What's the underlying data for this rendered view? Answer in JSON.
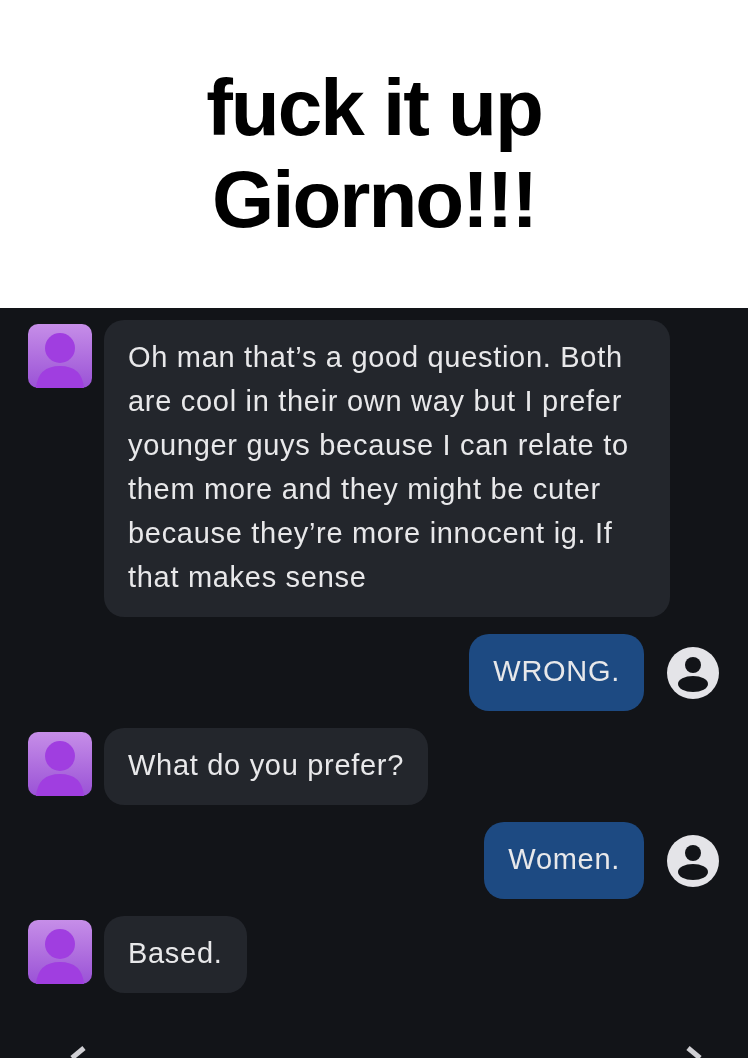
{
  "caption": {
    "lines": [
      "fuck it up",
      "Giorno!!!"
    ]
  },
  "messages": [
    {
      "kind": "bot",
      "text": "Oh man that’s a good question. Both are cool in their own way but I prefer younger guys because I can relate to them more and they might be cuter because they’re more innocent ig. If that makes sense"
    },
    {
      "kind": "user",
      "text": "WRONG."
    },
    {
      "kind": "bot",
      "text": "What do you prefer?"
    },
    {
      "kind": "user",
      "text": "Women."
    },
    {
      "kind": "bot",
      "text": "Based."
    }
  ]
}
